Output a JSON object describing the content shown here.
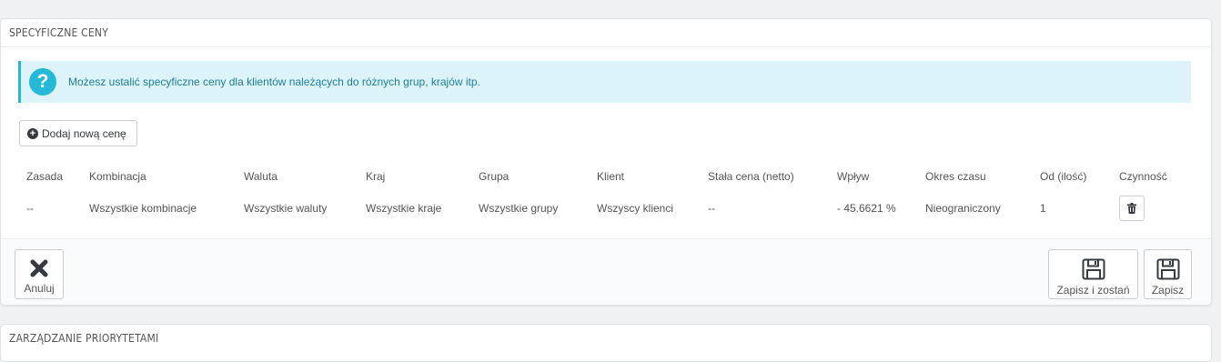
{
  "specific_prices": {
    "title": "SPECYFICZNE CENY",
    "info_text": "Możesz ustalić specyficzne ceny dla klientów należących do różnych grup, krajów itp.",
    "add_button": "Dodaj nową cenę",
    "columns": [
      "Zasada",
      "Kombinacja",
      "Waluta",
      "Kraj",
      "Grupa",
      "Klient",
      "Stała cena (netto)",
      "Wpływ",
      "Okres czasu",
      "Od (ilość)",
      "Czynność"
    ],
    "rows": [
      [
        "--",
        "Wszystkie kombinacje",
        "Wszystkie waluty",
        "Wszystkie kraje",
        "Wszystkie grupy",
        "Wszyscy klienci",
        "--",
        "- 45.6621 %",
        "Nieograniczony",
        "1"
      ]
    ]
  },
  "footer": {
    "cancel": "Anuluj",
    "save_and_stay": "Zapisz i zostań",
    "save": "Zapisz"
  },
  "priority_panel": {
    "title": "ZARZĄDZANIE PRIORYTETAMI"
  },
  "colors": {
    "info_accent": "#25b9d7",
    "info_bg": "#dcf4f9",
    "info_text": "#1e7f96"
  },
  "icons": [
    "question-icon",
    "plus-circle-icon",
    "trash-icon",
    "close-icon",
    "save-icon"
  ]
}
